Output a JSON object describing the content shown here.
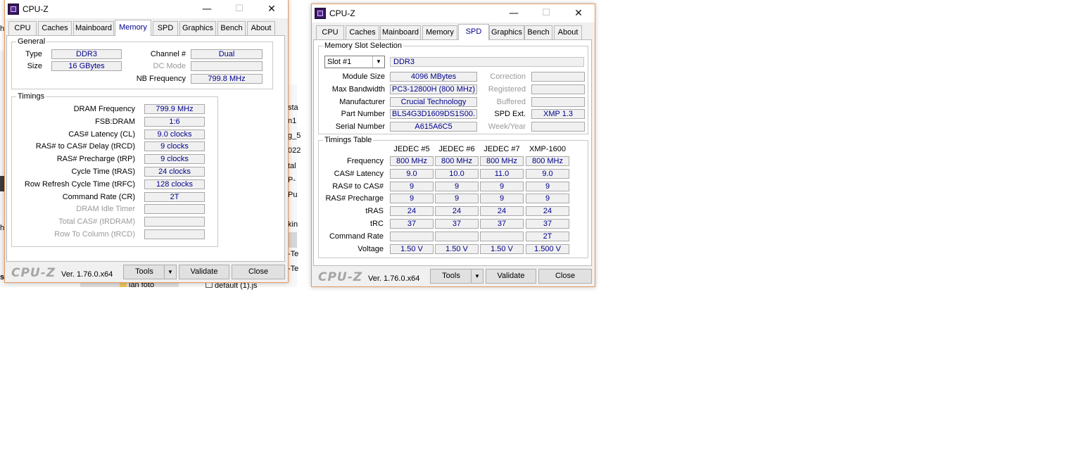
{
  "background": {
    "fragments": [
      "h",
      "h",
      "s",
      "sta",
      "n1",
      "g_5",
      "022",
      "tal",
      "P-",
      "Pu",
      "kin",
      "-Te",
      "-Te",
      "lan foto",
      "default (1).js"
    ]
  },
  "window1": {
    "title": "CPU-Z",
    "tabs": [
      "CPU",
      "Caches",
      "Mainboard",
      "Memory",
      "SPD",
      "Graphics",
      "Bench",
      "About"
    ],
    "active_tab": "Memory",
    "general": {
      "title": "General",
      "type_label": "Type",
      "type_value": "DDR3",
      "size_label": "Size",
      "size_value": "16 GBytes",
      "channel_label": "Channel #",
      "channel_value": "Dual",
      "dcmode_label": "DC Mode",
      "dcmode_value": "",
      "nbfreq_label": "NB Frequency",
      "nbfreq_value": "799.8 MHz"
    },
    "timings": {
      "title": "Timings",
      "rows": [
        {
          "label": "DRAM Frequency",
          "value": "799.9 MHz",
          "enabled": true
        },
        {
          "label": "FSB:DRAM",
          "value": "1:6",
          "enabled": true
        },
        {
          "label": "CAS# Latency (CL)",
          "value": "9.0 clocks",
          "enabled": true
        },
        {
          "label": "RAS# to CAS# Delay (tRCD)",
          "value": "9 clocks",
          "enabled": true
        },
        {
          "label": "RAS# Precharge (tRP)",
          "value": "9 clocks",
          "enabled": true
        },
        {
          "label": "Cycle Time (tRAS)",
          "value": "24 clocks",
          "enabled": true
        },
        {
          "label": "Row Refresh Cycle Time (tRFC)",
          "value": "128 clocks",
          "enabled": true
        },
        {
          "label": "Command Rate (CR)",
          "value": "2T",
          "enabled": true
        },
        {
          "label": "DRAM Idle Timer",
          "value": "",
          "enabled": false
        },
        {
          "label": "Total CAS# (tRDRAM)",
          "value": "",
          "enabled": false
        },
        {
          "label": "Row To Column (tRCD)",
          "value": "",
          "enabled": false
        }
      ]
    },
    "footer": {
      "logo": "CPU-Z",
      "version": "Ver. 1.76.0.x64",
      "tools": "Tools",
      "validate": "Validate",
      "close": "Close"
    }
  },
  "window2": {
    "title": "CPU-Z",
    "tabs": [
      "CPU",
      "Caches",
      "Mainboard",
      "Memory",
      "SPD",
      "Graphics",
      "Bench",
      "About"
    ],
    "active_tab": "SPD",
    "slot": {
      "title": "Memory Slot Selection",
      "selected": "Slot #1",
      "type": "DDR3",
      "left_rows": [
        {
          "label": "Module Size",
          "value": "4096 MBytes"
        },
        {
          "label": "Max Bandwidth",
          "value": "PC3-12800H (800 MHz)"
        },
        {
          "label": "Manufacturer",
          "value": "Crucial Technology"
        },
        {
          "label": "Part Number",
          "value": "BLS4G3D1609DS1S00."
        },
        {
          "label": "Serial Number",
          "value": "A615A6C5"
        }
      ],
      "right_rows": [
        {
          "label": "Correction",
          "value": "",
          "enabled": false
        },
        {
          "label": "Registered",
          "value": "",
          "enabled": false
        },
        {
          "label": "Buffered",
          "value": "",
          "enabled": false
        },
        {
          "label": "SPD Ext.",
          "value": "XMP 1.3",
          "enabled": true
        },
        {
          "label": "Week/Year",
          "value": "",
          "enabled": false
        }
      ]
    },
    "timings_table": {
      "title": "Timings Table",
      "columns": [
        "JEDEC #5",
        "JEDEC #6",
        "JEDEC #7",
        "XMP-1600"
      ],
      "rows": [
        {
          "label": "Frequency",
          "values": [
            "800 MHz",
            "800 MHz",
            "800 MHz",
            "800 MHz"
          ]
        },
        {
          "label": "CAS# Latency",
          "values": [
            "9.0",
            "10.0",
            "11.0",
            "9.0"
          ]
        },
        {
          "label": "RAS# to CAS#",
          "values": [
            "9",
            "9",
            "9",
            "9"
          ]
        },
        {
          "label": "RAS# Precharge",
          "values": [
            "9",
            "9",
            "9",
            "9"
          ]
        },
        {
          "label": "tRAS",
          "values": [
            "24",
            "24",
            "24",
            "24"
          ]
        },
        {
          "label": "tRC",
          "values": [
            "37",
            "37",
            "37",
            "37"
          ]
        },
        {
          "label": "Command Rate",
          "values": [
            "",
            "",
            "",
            "2T"
          ]
        },
        {
          "label": "Voltage",
          "values": [
            "1.50 V",
            "1.50 V",
            "1.50 V",
            "1.500 V"
          ]
        }
      ]
    },
    "footer": {
      "logo": "CPU-Z",
      "version": "Ver. 1.76.0.x64",
      "tools": "Tools",
      "validate": "Validate",
      "close": "Close"
    }
  }
}
